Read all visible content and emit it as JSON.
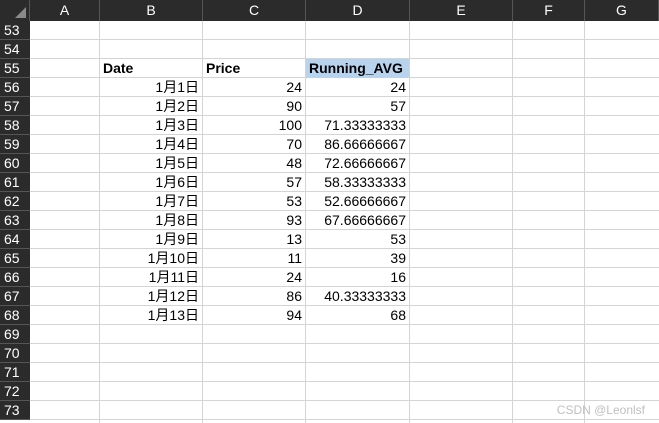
{
  "columns": [
    "A",
    "B",
    "C",
    "D",
    "E",
    "F",
    "G"
  ],
  "rows": [
    "53",
    "54",
    "55",
    "56",
    "57",
    "58",
    "59",
    "60",
    "61",
    "62",
    "63",
    "64",
    "65",
    "66",
    "67",
    "68",
    "69",
    "70",
    "71",
    "72",
    "73"
  ],
  "table": {
    "headers": [
      "Date",
      "Price",
      "Running_AVG"
    ],
    "records": [
      [
        "1月1日",
        "24",
        "24"
      ],
      [
        "1月2日",
        "90",
        "57"
      ],
      [
        "1月3日",
        "100",
        "71.33333333"
      ],
      [
        "1月4日",
        "70",
        "86.66666667"
      ],
      [
        "1月5日",
        "48",
        "72.66666667"
      ],
      [
        "1月6日",
        "57",
        "58.33333333"
      ],
      [
        "1月7日",
        "53",
        "52.66666667"
      ],
      [
        "1月8日",
        "93",
        "67.66666667"
      ],
      [
        "1月9日",
        "13",
        "53"
      ],
      [
        "1月10日",
        "11",
        "39"
      ],
      [
        "1月11日",
        "24",
        "16"
      ],
      [
        "1月12日",
        "86",
        "40.33333333"
      ],
      [
        "1月13日",
        "94",
        "68"
      ]
    ]
  },
  "selected_cell": "D55",
  "colors": {
    "header_bg": "#2b2b2b",
    "selection": "#b8d3ee",
    "gridline": "#d4d4d4"
  },
  "watermark": "CSDN @Leonlsf"
}
